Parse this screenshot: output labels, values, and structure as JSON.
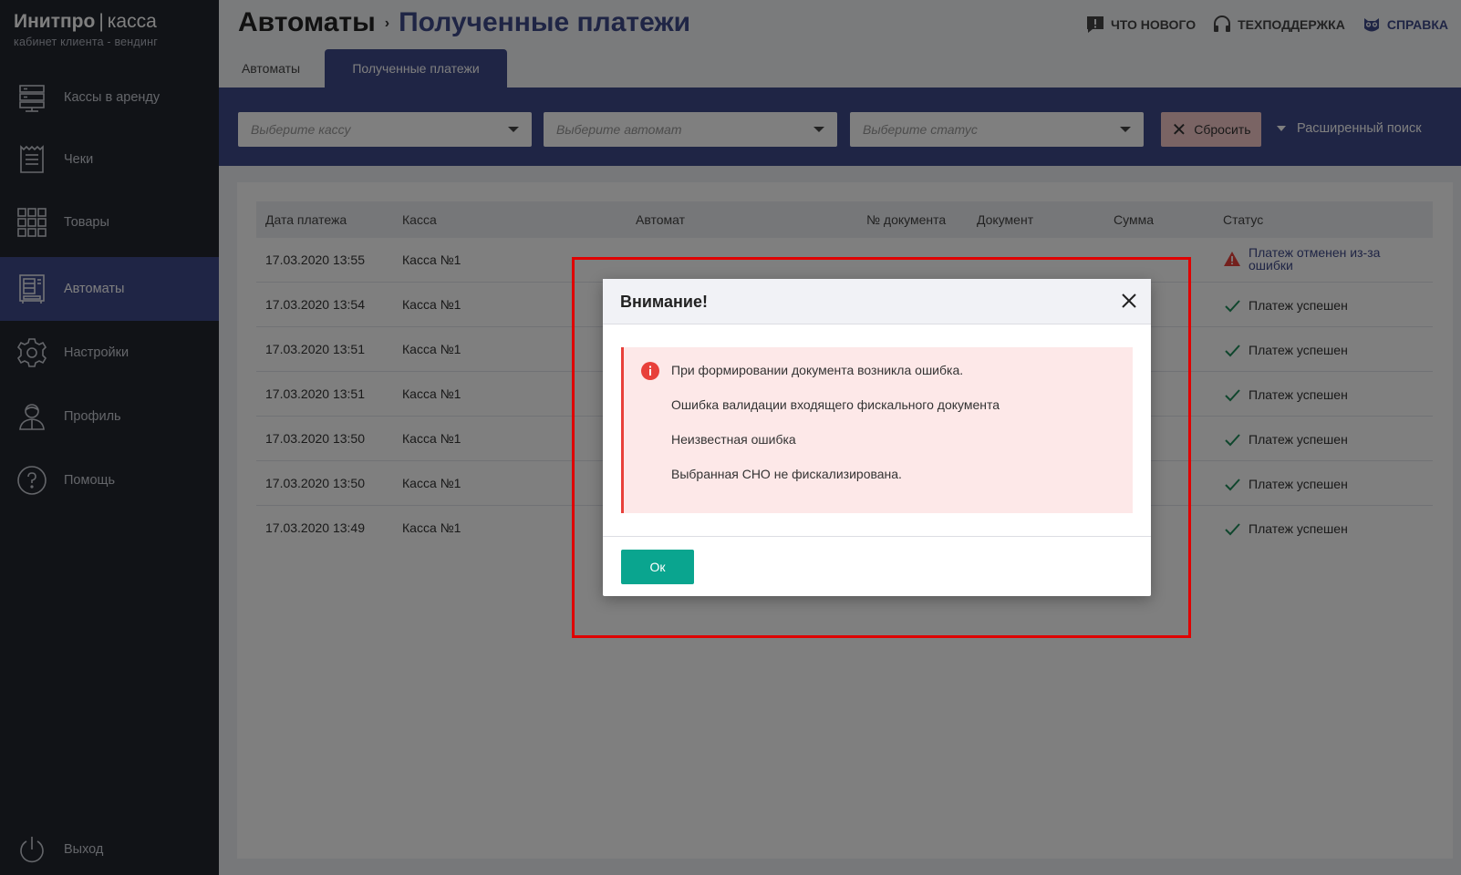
{
  "brand": {
    "title_bold": "Инитпро",
    "title_sep": "|",
    "title_rest": "касса",
    "subtitle": "кабинет клиента - вендинг"
  },
  "sidebar": {
    "items": [
      {
        "label": "Кассы в аренду",
        "icon": "server-icon"
      },
      {
        "label": "Чеки",
        "icon": "receipt-icon"
      },
      {
        "label": "Товары",
        "icon": "grid-icon"
      },
      {
        "label": "Автоматы",
        "icon": "vending-machine-icon",
        "active": true
      },
      {
        "label": "Настройки",
        "icon": "gear-icon"
      },
      {
        "label": "Профиль",
        "icon": "user-icon"
      },
      {
        "label": "Помощь",
        "icon": "help-icon"
      }
    ],
    "logout": {
      "label": "Выход",
      "icon": "power-icon"
    }
  },
  "header": {
    "breadcrumb_root": "Автоматы",
    "breadcrumb_arrow": "›",
    "breadcrumb_current": "Полученные платежи",
    "links": {
      "whats_new": "ЧТО НОВОГО",
      "support": "ТЕХПОДДЕРЖКА",
      "help": "СПРАВКА"
    }
  },
  "tabs": {
    "machines": "Автоматы",
    "payments": "Полученные платежи"
  },
  "filters": {
    "kassa_placeholder": "Выберите кассу",
    "machine_placeholder": "Выберите автомат",
    "status_placeholder": "Выберите статус",
    "reset_label": "Сбросить",
    "advanced_label": "Расширенный поиск"
  },
  "table": {
    "columns": [
      "Дата платежа",
      "Касса",
      "Автомат",
      "№ документа",
      "Документ",
      "Сумма",
      "Статус"
    ],
    "rows": [
      {
        "date": "17.03.2020 13:55",
        "kassa": "Касса №1",
        "status": "Платеж отменен из-за ошибки",
        "status_type": "error"
      },
      {
        "date": "17.03.2020 13:54",
        "kassa": "Касса №1",
        "status": "Платеж успешен",
        "status_type": "ok"
      },
      {
        "date": "17.03.2020 13:51",
        "kassa": "Касса №1",
        "status": "Платеж успешен",
        "status_type": "ok"
      },
      {
        "date": "17.03.2020 13:51",
        "kassa": "Касса №1",
        "status": "Платеж успешен",
        "status_type": "ok"
      },
      {
        "date": "17.03.2020 13:50",
        "kassa": "Касса №1",
        "status": "Платеж успешен",
        "status_type": "ok"
      },
      {
        "date": "17.03.2020 13:50",
        "kassa": "Касса №1",
        "status": "Платеж успешен",
        "status_type": "ok"
      },
      {
        "date": "17.03.2020 13:49",
        "kassa": "Касса №1",
        "status": "Платеж успешен",
        "status_type": "ok"
      }
    ]
  },
  "modal": {
    "title": "Внимание!",
    "lines": [
      "При формировании документа возникла ошибка.",
      "Ошибка валидации входящего фискального документа",
      "Неизвестная ошибка",
      "Выбранная СНО не фискализирована."
    ],
    "ok_label": "Ок"
  },
  "colors": {
    "brand": "#3f4a8a",
    "sidebar": "#23262f",
    "ok_button": "#0aa58f",
    "alert_bg": "#fde8e8",
    "error": "#e8403a",
    "success": "#1e8c5a",
    "highlight": "#e00000"
  }
}
